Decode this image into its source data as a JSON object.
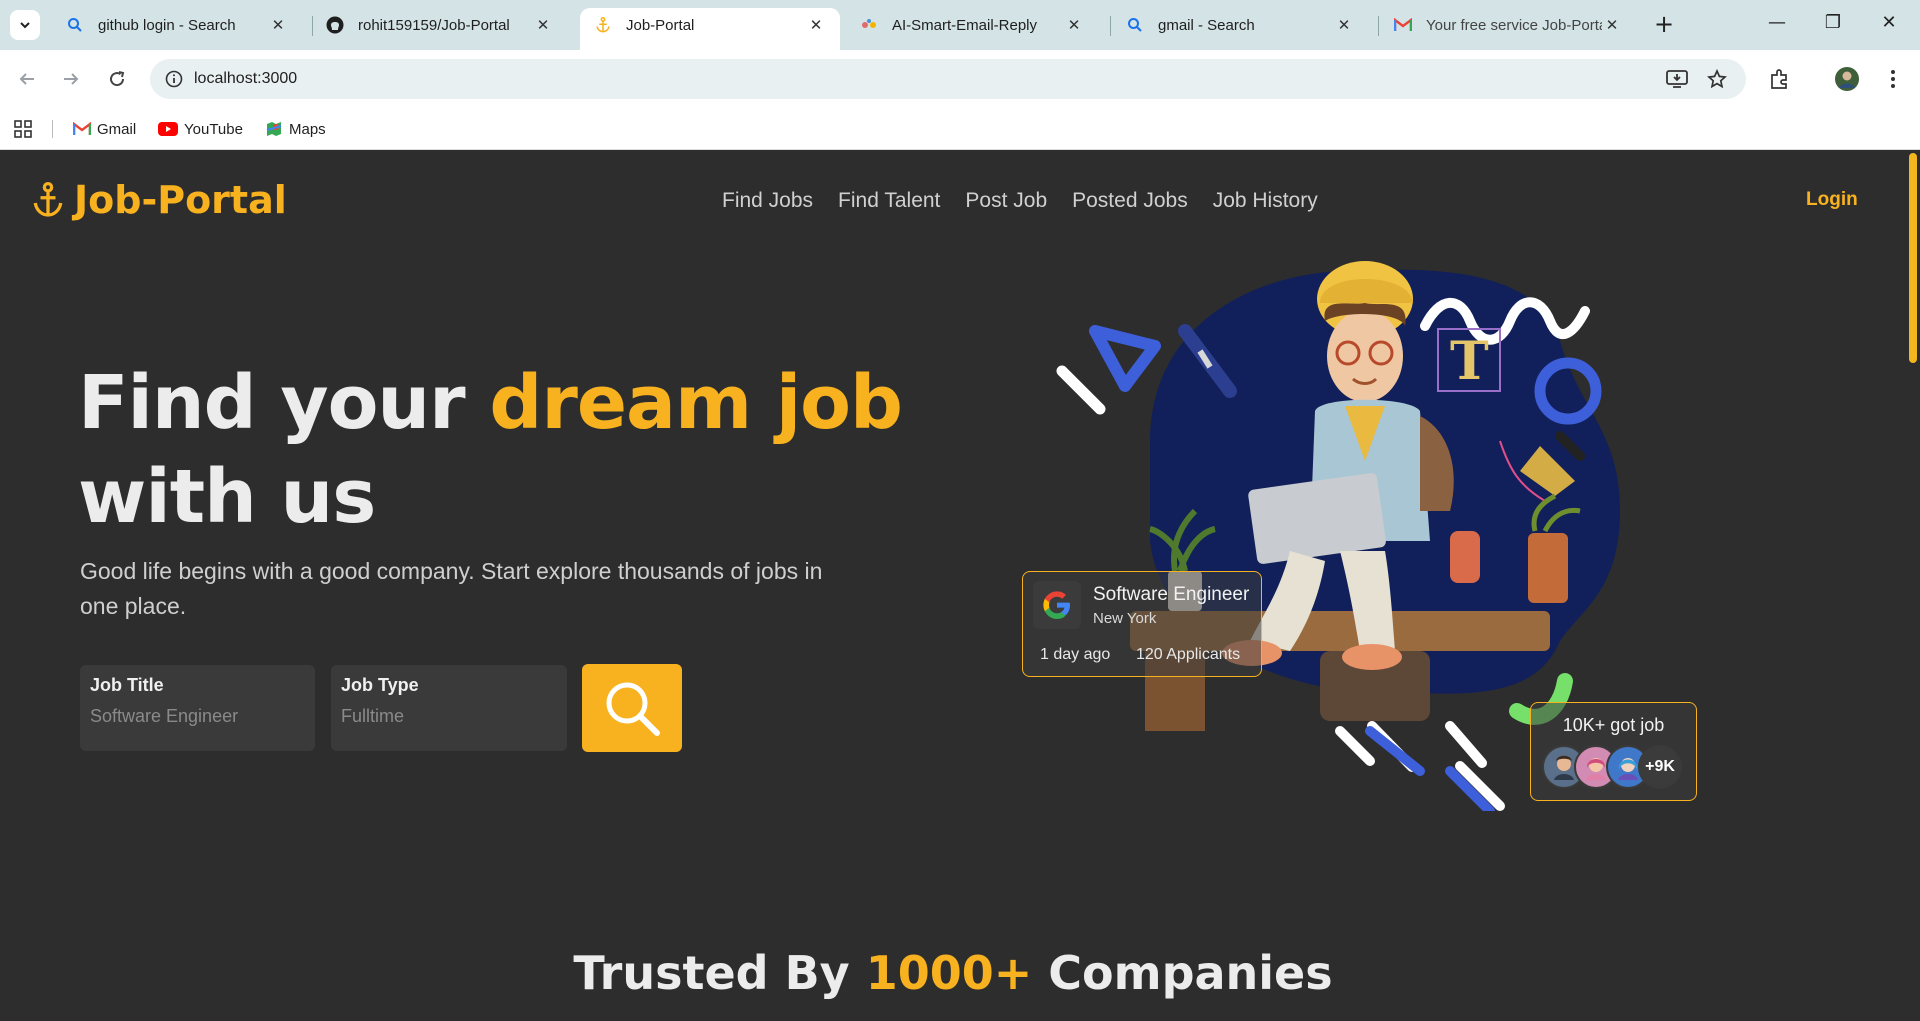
{
  "browser": {
    "tabs": [
      {
        "title": "github login - Search",
        "icon": "search-icon"
      },
      {
        "title": "rohit159159/Job-Portal",
        "icon": "github-icon"
      },
      {
        "title": "Job-Portal",
        "icon": "anchor-icon",
        "active": true
      },
      {
        "title": "AI-Smart-Email-Reply",
        "icon": "app-icon"
      },
      {
        "title": "gmail - Search",
        "icon": "search-icon"
      },
      {
        "title": "Your free service Job-Porta",
        "icon": "gmail-icon"
      }
    ],
    "url": "localhost:3000",
    "bookmarks": [
      {
        "label": "Gmail",
        "icon": "gmail-icon"
      },
      {
        "label": "YouTube",
        "icon": "youtube-icon"
      },
      {
        "label": "Maps",
        "icon": "maps-icon"
      }
    ]
  },
  "site": {
    "logo": "Job-Portal",
    "nav": [
      "Find Jobs",
      "Find Talent",
      "Post Job",
      "Posted Jobs",
      "Job History"
    ],
    "login": "Login"
  },
  "hero": {
    "title_part1": "Find your ",
    "title_highlight": "dream job",
    "title_part2": "with us",
    "subtitle": "Good life begins with a good company. Start explore thousands of jobs in one place.",
    "job_title_label": "Job Title",
    "job_title_placeholder": "Software Engineer",
    "job_type_label": "Job Type",
    "job_type_placeholder": "Fulltime"
  },
  "job_card": {
    "role": "Software Engineer",
    "location": "New York",
    "posted": "1 day ago",
    "applicants": "120 Applicants"
  },
  "stat_card": {
    "text": "10K+ got job",
    "more": "+9K"
  },
  "trusted": {
    "prefix": "Trusted By ",
    "highlight": "1000+",
    "suffix": " Companies"
  },
  "colors": {
    "accent": "#f9b21f",
    "background": "#2d2d2d"
  }
}
